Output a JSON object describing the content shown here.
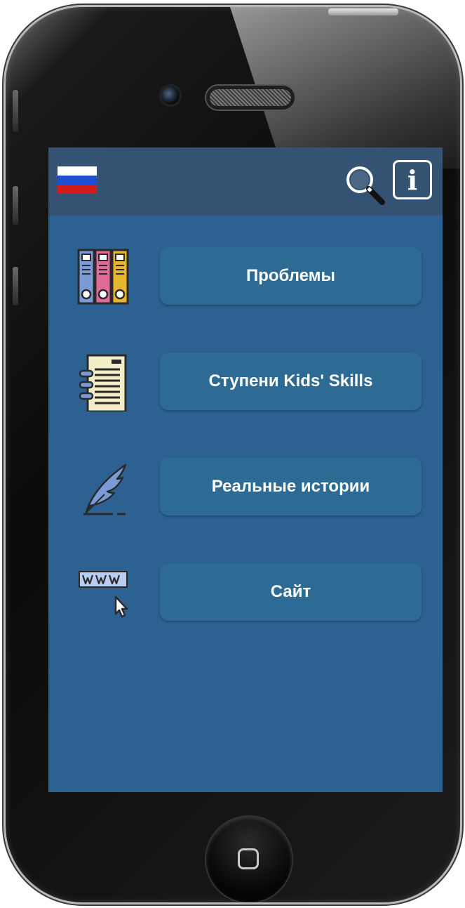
{
  "header": {
    "language_flag": "russian-flag-icon",
    "search_icon": "search-icon",
    "info_icon": "info-icon",
    "info_glyph": "i"
  },
  "menu": {
    "items": [
      {
        "label": "Проблемы",
        "icon": "binders-icon"
      },
      {
        "label": "Ступени Kids' Skills",
        "icon": "notebook-icon"
      },
      {
        "label": "Реальные истории",
        "icon": "quill-icon"
      },
      {
        "label": "Сайт",
        "icon": "www-cursor-icon"
      }
    ]
  },
  "colors": {
    "screen_background": "#2c6191",
    "header_background": "#345373",
    "button_background": "#2d6a94",
    "button_text": "#ffffff"
  }
}
